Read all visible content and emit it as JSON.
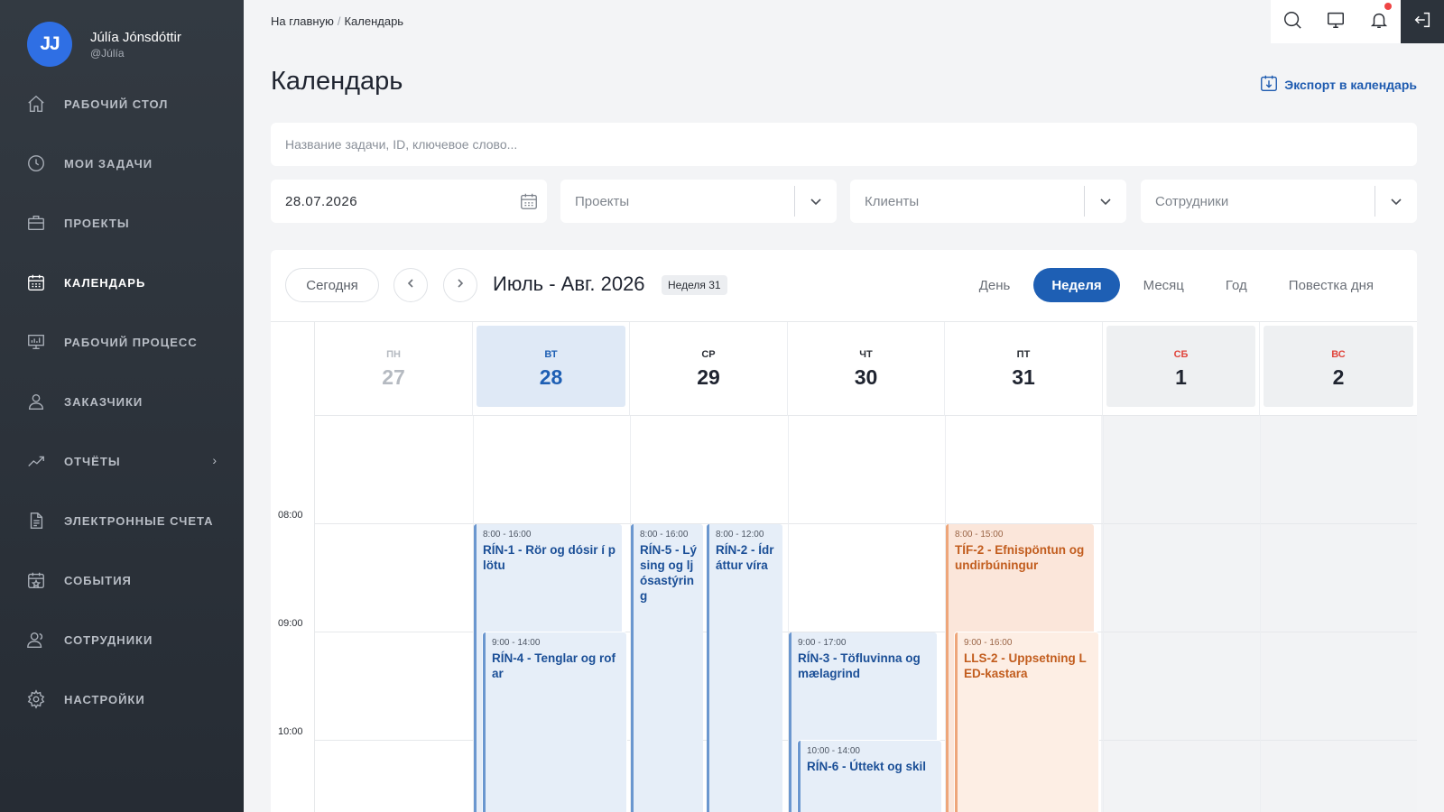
{
  "user": {
    "initials": "JJ",
    "name": "Júlía Jónsdóttir",
    "handle": "@Júlía"
  },
  "sidebar": {
    "items": [
      {
        "label": "РАБОЧИЙ СТОЛ",
        "icon": "home-icon"
      },
      {
        "label": "МОИ ЗАДАЧИ",
        "icon": "clock-icon"
      },
      {
        "label": "ПРОЕКТЫ",
        "icon": "briefcase-icon"
      },
      {
        "label": "КАЛЕНДАРЬ",
        "icon": "calendar-icon",
        "active": true
      },
      {
        "label": "РАБОЧИЙ ПРОЦЕСС",
        "icon": "presentation-icon"
      },
      {
        "label": "ЗАКАЗЧИКИ",
        "icon": "user-icon"
      },
      {
        "label": "ОТЧЁТЫ",
        "icon": "chart-line-icon",
        "has_submenu": true
      },
      {
        "label": "ЭЛЕКТРОННЫЕ СЧЕТА",
        "icon": "document-icon"
      },
      {
        "label": "СОБЫТИЯ",
        "icon": "calendar-star-icon"
      },
      {
        "label": "СОТРУДНИКИ",
        "icon": "users-icon"
      },
      {
        "label": "НАСТРОЙКИ",
        "icon": "gear-icon"
      }
    ]
  },
  "topbar": {
    "icons": [
      "search-icon",
      "monitor-icon",
      "bell-icon",
      "logout-icon"
    ],
    "has_notification": true
  },
  "breadcrumb": {
    "home": "На главную",
    "separator": "/",
    "current": "Календарь"
  },
  "page": {
    "title": "Календарь",
    "export_label": "Экспорт в календарь"
  },
  "search": {
    "placeholder": "Название задачи, ID, ключевое слово..."
  },
  "filters": {
    "date": "28.07.2026",
    "projects": "Проекты",
    "clients": "Клиенты",
    "employees": "Сотрудники"
  },
  "calendar": {
    "today_label": "Сегодня",
    "range": "Июль - Авг. 2026",
    "week_badge": "Неделя 31",
    "views": [
      "День",
      "Неделя",
      "Месяц",
      "Год",
      "Повестка дня"
    ],
    "active_view": "Неделя",
    "days": [
      {
        "dow": "ПН",
        "num": "27",
        "state": "past"
      },
      {
        "dow": "ВТ",
        "num": "28",
        "state": "today"
      },
      {
        "dow": "СР",
        "num": "29",
        "state": "normal"
      },
      {
        "dow": "ЧТ",
        "num": "30",
        "state": "normal"
      },
      {
        "dow": "ПТ",
        "num": "31",
        "state": "normal"
      },
      {
        "dow": "СБ",
        "num": "1",
        "state": "weekend"
      },
      {
        "dow": "ВС",
        "num": "2",
        "state": "weekend"
      }
    ],
    "times": [
      "08:00",
      "09:00",
      "10:00"
    ],
    "events": [
      {
        "time": "8:00 - 16:00",
        "title": "RÍN-1 - Rör og dósir í plötu",
        "day": 1,
        "color": "blue"
      },
      {
        "time": "9:00 - 14:00",
        "title": "RÍN-4 - Tenglar og rofar",
        "day": 1,
        "color": "blue"
      },
      {
        "time": "8:00 - 16:00",
        "title": "RÍN-5 - Lýsing og ljósastýring",
        "day": 2,
        "color": "blue"
      },
      {
        "time": "8:00 - 12:00",
        "title": "RÍN-2 - Ídráttur víra",
        "day": 2,
        "color": "blue"
      },
      {
        "time": "9:00 - 17:00",
        "title": "RÍN-3 - Töfluvinna og mælagrind",
        "day": 3,
        "color": "blue"
      },
      {
        "time": "10:00 - 14:00",
        "title": "RÍN-6 - Úttekt og skil",
        "day": 3,
        "color": "blue"
      },
      {
        "time": "8:00 - 15:00",
        "title": "TÍF-2 - Efnispöntun og undirbúningur",
        "day": 4,
        "color": "orange"
      },
      {
        "time": "9:00 - 16:00",
        "title": "LLS-2 - Uppsetning LED-kastara",
        "day": 4,
        "color": "orange"
      }
    ]
  },
  "colors": {
    "accent": "#1e5fb4",
    "sidebar_bg": "#2d333b",
    "avatar": "#2f6fe4",
    "weekend_text": "#e0453c",
    "event_blue": "#e6eef8",
    "event_orange": "#fbe6da"
  }
}
